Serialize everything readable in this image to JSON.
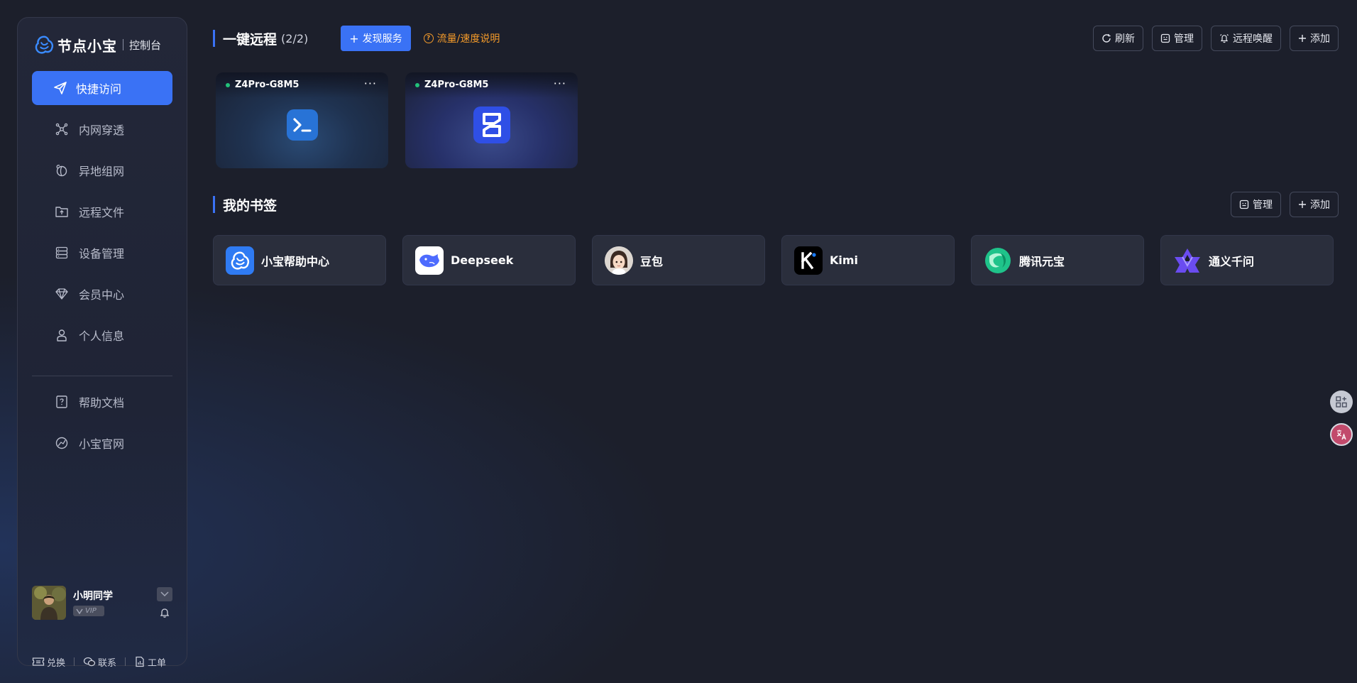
{
  "brand": {
    "name": "节点小宝",
    "subtitle": "控制台"
  },
  "nav": {
    "items": [
      {
        "label": "快捷访问",
        "icon": "send-icon",
        "active": true
      },
      {
        "label": "内网穿透",
        "icon": "network-icon"
      },
      {
        "label": "异地组网",
        "icon": "globe-link-icon"
      },
      {
        "label": "远程文件",
        "icon": "folder-upload-icon"
      },
      {
        "label": "设备管理",
        "icon": "server-icon"
      },
      {
        "label": "会员中心",
        "icon": "diamond-icon"
      },
      {
        "label": "个人信息",
        "icon": "user-icon"
      }
    ],
    "secondary": [
      {
        "label": "帮助文档",
        "icon": "help-doc-icon"
      },
      {
        "label": "小宝官网",
        "icon": "compass-icon"
      }
    ]
  },
  "user": {
    "name": "小明同学",
    "badge": "VIP"
  },
  "footer": {
    "redeem": "兑换",
    "contact": "联系",
    "ticket": "工单"
  },
  "remote": {
    "title": "一键远程",
    "count": "(2/2)",
    "discover_label": "发现服务",
    "plus": "+",
    "traffic_link": "流量/速度说明",
    "tools": {
      "refresh": "刷新",
      "manage": "管理",
      "wake": "远程唤醒",
      "add": "添加"
    },
    "cards": [
      {
        "name": "Z4Pro-G8M5",
        "more": "···",
        "icon": "terminal-icon",
        "status": "online"
      },
      {
        "name": "Z4Pro-G8M5",
        "more": "···",
        "icon": "app-s-icon",
        "status": "online"
      }
    ]
  },
  "bookmarks": {
    "title": "我的书签",
    "tools": {
      "manage": "管理",
      "add": "添加"
    },
    "items": [
      {
        "label": "小宝帮助中心",
        "icon": "xiaobao-icon"
      },
      {
        "label": "Deepseek",
        "icon": "deepseek-whale-icon"
      },
      {
        "label": "豆包",
        "icon": "doubao-avatar-icon"
      },
      {
        "label": "Kimi",
        "icon": "kimi-icon"
      },
      {
        "label": "腾讯元宝",
        "icon": "yuanbao-icon"
      },
      {
        "label": "通义千问",
        "icon": "tongyi-icon"
      }
    ]
  },
  "colors": {
    "accent": "#3a72f5",
    "warning": "#f39a2a",
    "online": "#22c27a",
    "background": "#1c1f2b"
  }
}
